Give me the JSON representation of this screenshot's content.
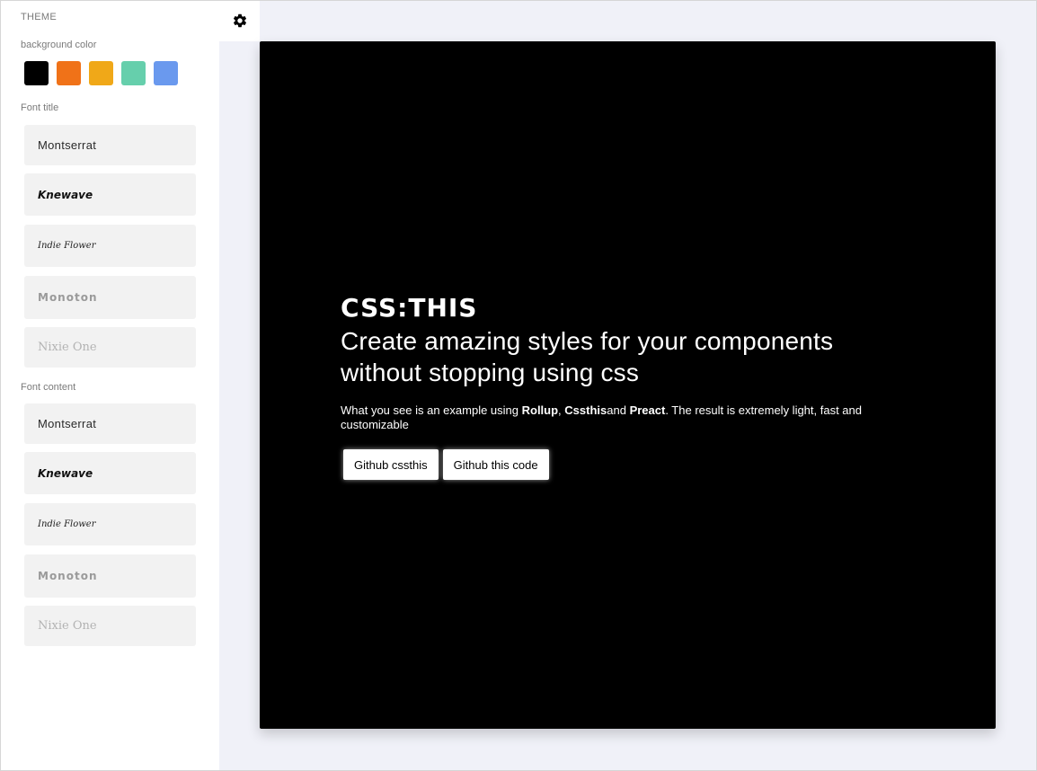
{
  "sidebar": {
    "theme_label": "THEME",
    "background_label": "background color",
    "swatches": [
      {
        "name": "black",
        "color": "#000000"
      },
      {
        "name": "orange",
        "color": "#f07218"
      },
      {
        "name": "yellow",
        "color": "#f0a818"
      },
      {
        "name": "teal",
        "color": "#66cfac"
      },
      {
        "name": "blue",
        "color": "#6a99ee"
      }
    ],
    "font_title_label": "Font title",
    "font_title_options": [
      "Montserrat",
      "Knewave",
      "Indie Flower",
      "Monoton",
      "Nixie One"
    ],
    "font_content_label": "Font content",
    "font_content_options": [
      "Montserrat",
      "Knewave",
      "Indie Flower",
      "Monoton",
      "Nixie One"
    ]
  },
  "settings_icon": "gear-icon",
  "preview": {
    "logo": "CSS:THIS",
    "headline": "Create amazing styles for your components without stopping using css",
    "desc_prefix": "What you see is an example using ",
    "desc_rollup": "Rollup",
    "desc_comma": ", ",
    "desc_cssthis": "Cssthis",
    "desc_and": "and ",
    "desc_preact": "Preact",
    "desc_suffix": ". The result is extremely light, fast and customizable",
    "buttons": [
      "Github cssthis",
      "Github this code"
    ]
  },
  "colors": {
    "page_bg": "#f0f1f8",
    "card_bg": "#000000",
    "option_bg": "#f2f2f2"
  }
}
